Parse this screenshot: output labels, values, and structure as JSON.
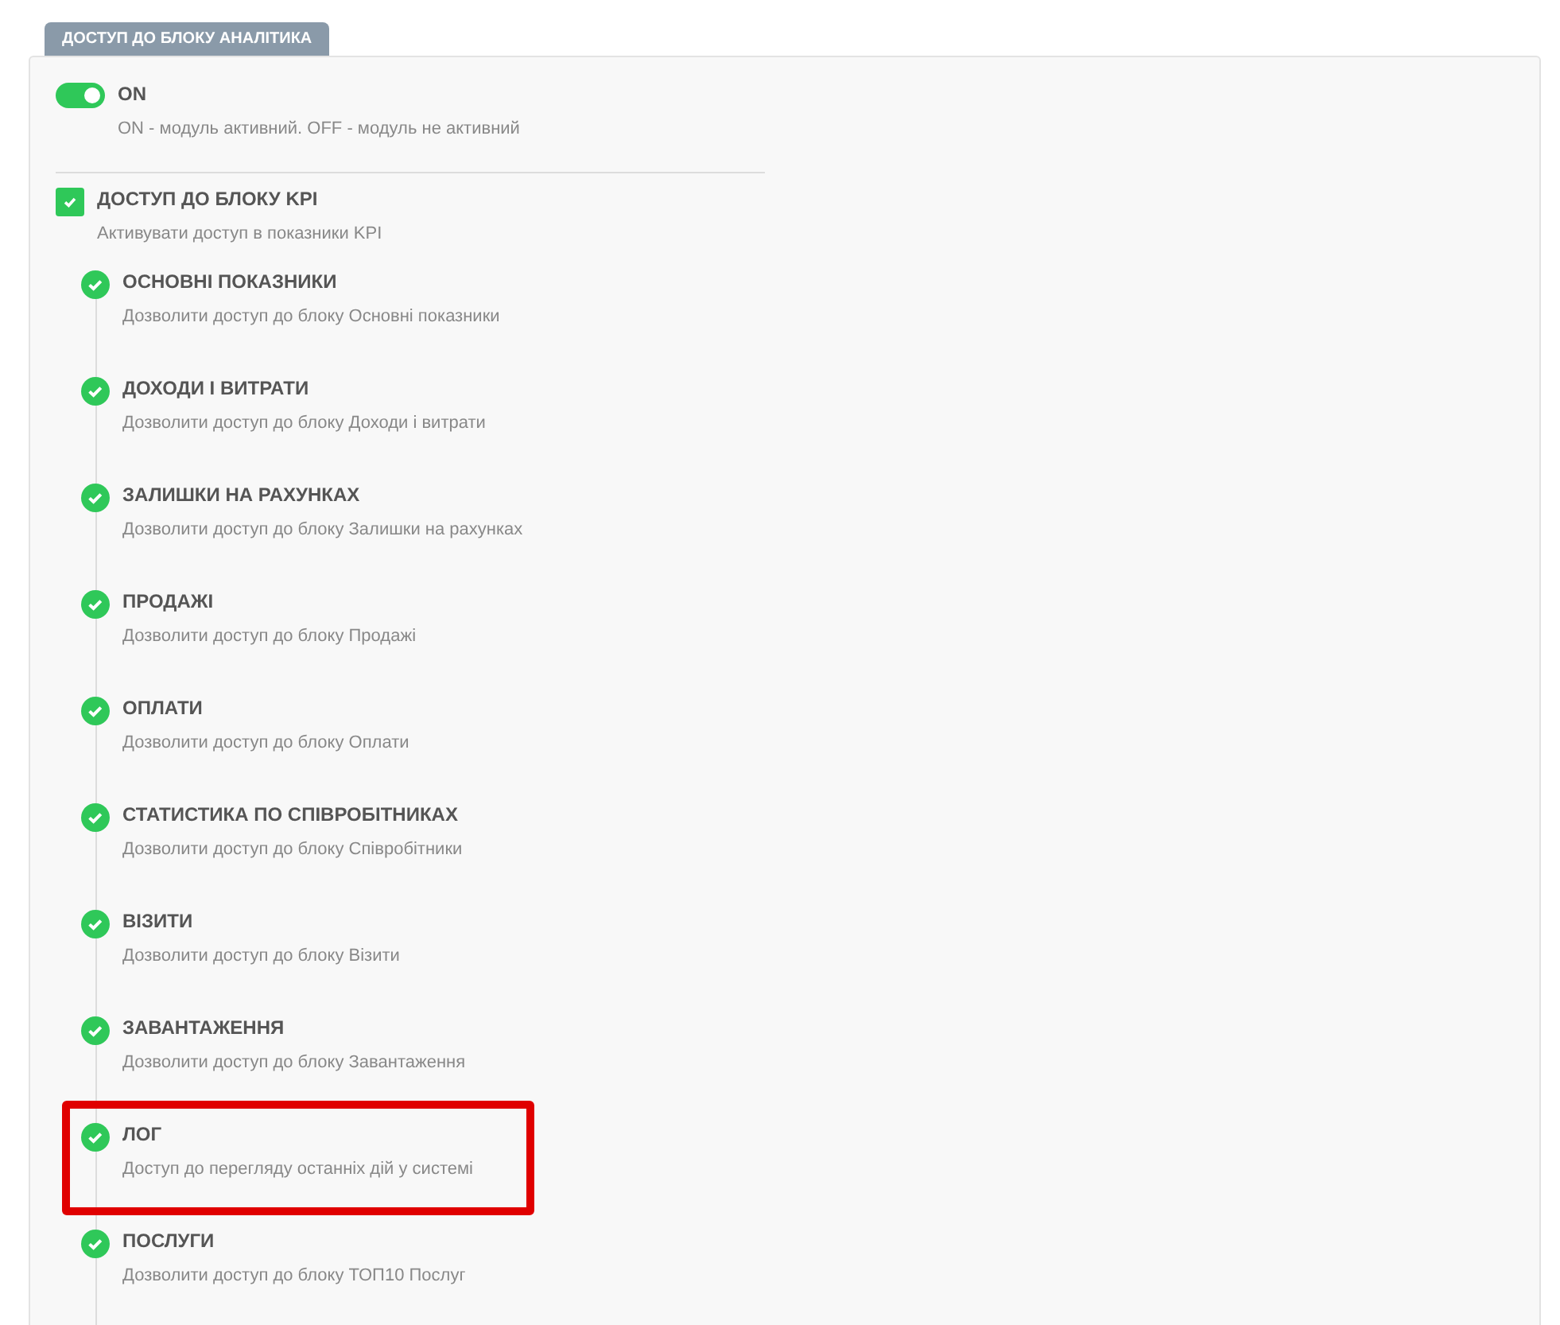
{
  "tab": {
    "label": "ДОСТУП ДО БЛОКУ АНАЛІТИКА"
  },
  "module": {
    "on": true,
    "label": "ON",
    "description": "ON - модуль активний. OFF - модуль не активний"
  },
  "kpi": {
    "checked": true,
    "title": "ДОСТУП ДО БЛОКУ KPI",
    "description": "Активувати доступ в показники KPI"
  },
  "items": [
    {
      "title": "ОСНОВНІ ПОКАЗНИКИ",
      "description": "Дозволити доступ до блоку Основні показники",
      "checked": true,
      "highlighted": false
    },
    {
      "title": "ДОХОДИ І ВИТРАТИ",
      "description": "Дозволити доступ до блоку Доходи і витрати",
      "checked": true,
      "highlighted": false
    },
    {
      "title": "ЗАЛИШКИ НА РАХУНКАХ",
      "description": "Дозволити доступ до блоку Залишки на рахунках",
      "checked": true,
      "highlighted": false
    },
    {
      "title": "ПРОДАЖІ",
      "description": "Дозволити доступ до блоку Продажі",
      "checked": true,
      "highlighted": false
    },
    {
      "title": "ОПЛАТИ",
      "description": "Дозволити доступ до блоку Оплати",
      "checked": true,
      "highlighted": false
    },
    {
      "title": "СТАТИСТИКА ПО СПІВРОБІТНИКАХ",
      "description": "Дозволити доступ до блоку Співробітники",
      "checked": true,
      "highlighted": false
    },
    {
      "title": "ВІЗИТИ",
      "description": "Дозволити доступ до блоку Візити",
      "checked": true,
      "highlighted": false
    },
    {
      "title": "ЗАВАНТАЖЕННЯ",
      "description": "Дозволити доступ до блоку Завантаження",
      "checked": true,
      "highlighted": false
    },
    {
      "title": "ЛОГ",
      "description": "Доступ до перегляду останніх дій у системі",
      "checked": true,
      "highlighted": true
    },
    {
      "title": "ПОСЛУГИ",
      "description": "Дозволити доступ до блоку ТОП10 Послуг",
      "checked": true,
      "highlighted": false
    }
  ]
}
